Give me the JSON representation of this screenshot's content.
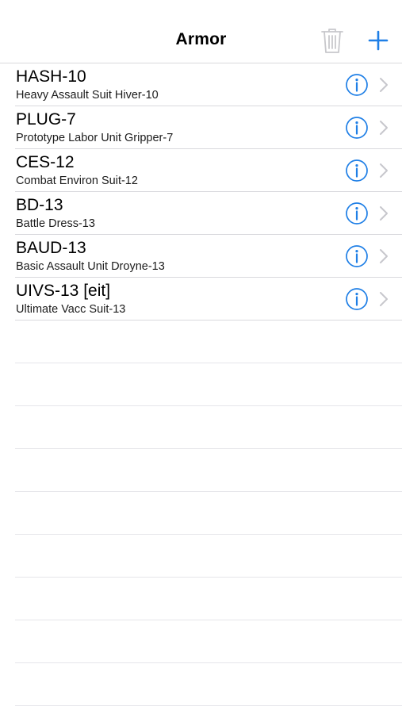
{
  "navbar": {
    "title": "Armor",
    "trash_icon": "trash-icon",
    "add_icon": "plus-icon",
    "accent_color": "#1f7fe6",
    "disabled_color": "#c8c8cc"
  },
  "armor": [
    {
      "code": "HASH-10",
      "name": "Heavy Assault Suit Hiver-10"
    },
    {
      "code": "PLUG-7",
      "name": "Prototype Labor Unit Gripper-7"
    },
    {
      "code": "CES-12",
      "name": "Combat Environ Suit-12"
    },
    {
      "code": "BD-13",
      "name": "Battle Dress-13"
    },
    {
      "code": "BAUD-13",
      "name": "Basic Assault Unit Droyne-13"
    },
    {
      "code": "UIVS-13 [eit]",
      "name": "Ultimate Vacc Suit-13"
    }
  ]
}
